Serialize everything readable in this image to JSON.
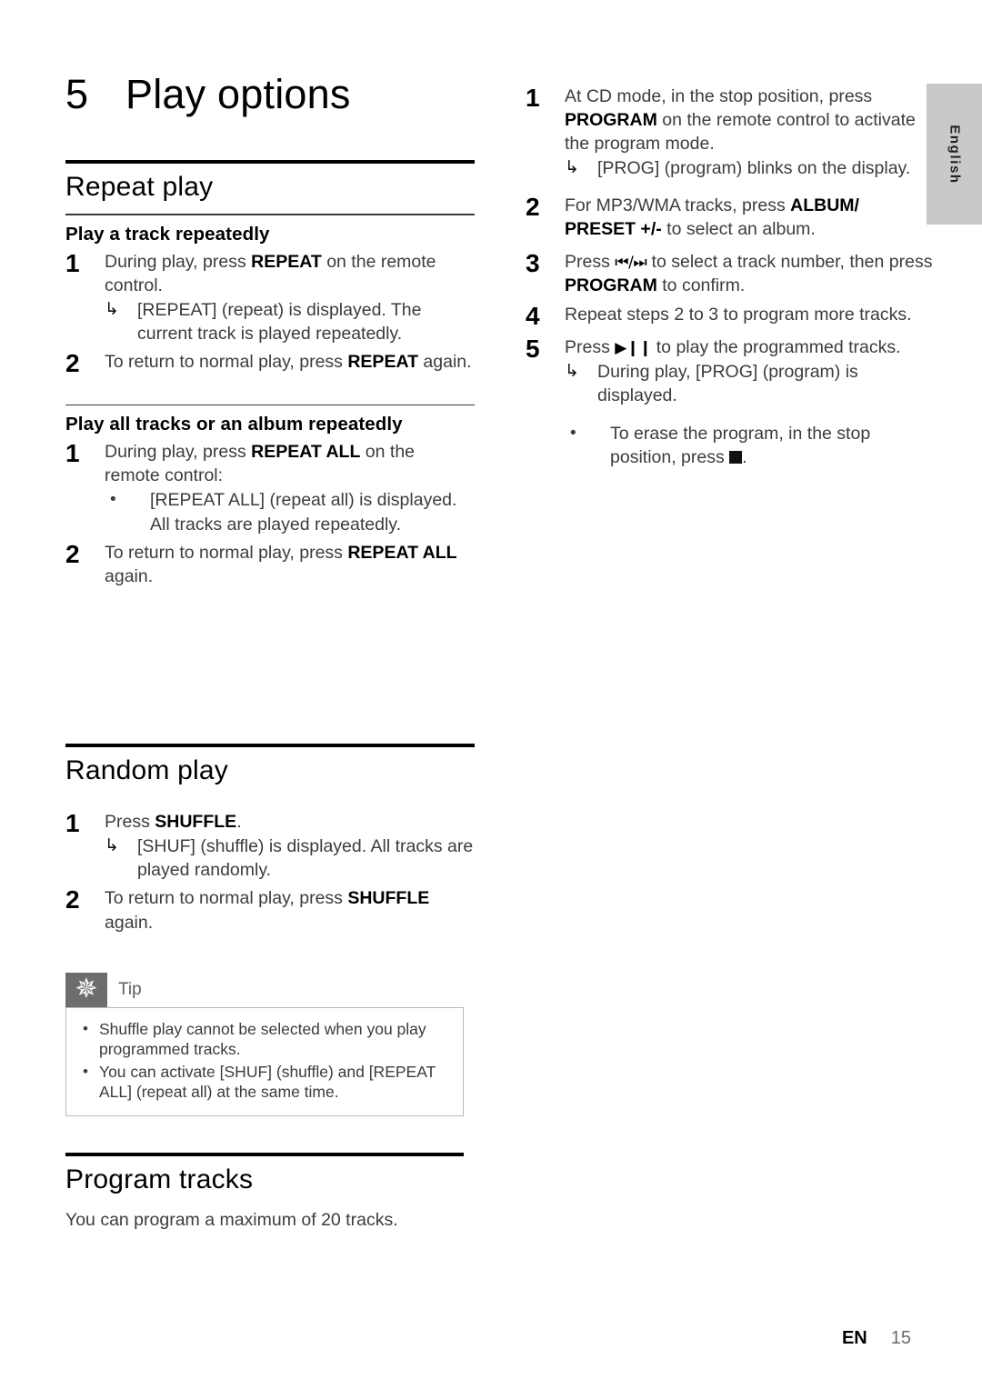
{
  "page": {
    "chapter_number": "5",
    "chapter_title": "Play options",
    "language_tab": "English",
    "footer_locale": "EN",
    "footer_page": "15",
    "accent_gray": "#c9c9c9",
    "tip_icon_bg": "#6d6d6d"
  },
  "repeat_play": {
    "section_title": "Repeat play",
    "sub_a": {
      "title": "Play a track repeatedly",
      "step1_num": "1",
      "step1_a": "During play, press ",
      "step1_b": "REPEAT",
      "step1_c": " on the remote control.",
      "step1_result_mark": "↳",
      "step1_result": "[REPEAT] (repeat) is displayed. The current track is played repeatedly.",
      "step2_num": "2",
      "step2_a": "To return to normal play, press ",
      "step2_b": "REPEAT",
      "step2_c": " again."
    },
    "sub_b": {
      "title": "Play all tracks or an album repeatedly",
      "step1_num": "1",
      "step1_a": "During play, press ",
      "step1_b": "REPEAT ALL",
      "step1_c": " on the remote control:",
      "step1_bullet_mark": "•",
      "step1_bullet": "[REPEAT ALL] (repeat all) is displayed. All tracks are played repeatedly.",
      "step2_num": "2",
      "step2_a": "To return to normal play, press ",
      "step2_b": "REPEAT ALL",
      "step2_c": " again."
    }
  },
  "random_play": {
    "section_title": "Random play",
    "step1_num": "1",
    "step1_a": "Press ",
    "step1_b": "SHUFFLE",
    "step1_c": ".",
    "step1_result_mark": "↳",
    "step1_result": "[SHUF] (shuffle) is displayed. All tracks are played randomly.",
    "step2_num": "2",
    "step2_a": "To return to normal play, press ",
    "step2_b": "SHUFFLE",
    "step2_c": " again."
  },
  "tip": {
    "icon": "asterisk-star-icon",
    "label": "Tip",
    "bullet_mark": "•",
    "item1": "Shuffle play cannot be selected when you play programmed tracks.",
    "item2": "You can activate [SHUF] (shuffle) and [REPEAT ALL] (repeat all) at the same time."
  },
  "program_tracks": {
    "section_title": "Program tracks",
    "intro": "You can program a maximum of 20 tracks.",
    "step1_num": "1",
    "step1_a": "At CD mode, in the stop position, press ",
    "step1_b": "PROGRAM",
    "step1_c": " on the remote control to activate the program mode.",
    "step1_result_mark": "↳",
    "step1_result": "[PROG] (program) blinks on the display.",
    "step2_num": "2",
    "step2_a": "For MP3/WMA tracks, press ",
    "step2_b": "ALBUM/ PRESET +/-",
    "step2_c": " to select an album.",
    "step3_num": "3",
    "step3_a": "Press ",
    "step3_glyph_prev": "⏮",
    "step3_glyph_sep": "/",
    "step3_glyph_next": "⏭",
    "step3_b": " to select a track number, then press ",
    "step3_c": "PROGRAM",
    "step3_d": " to confirm.",
    "step4_num": "4",
    "step4_a": "Repeat steps 2 to 3 to program more tracks.",
    "step5_num": "5",
    "step5_a": "Press ",
    "step5_glyph_play": "▶",
    "step5_glyph_pause": "❙❙",
    "step5_b": " to play the programmed tracks.",
    "step5_result_mark": "↳",
    "step5_result": "During play, [PROG] (program) is displayed.",
    "step5_bullet_mark": "•",
    "step5_bullet_a": "To erase the program, in the stop position, press ",
    "step5_bullet_b": "."
  }
}
